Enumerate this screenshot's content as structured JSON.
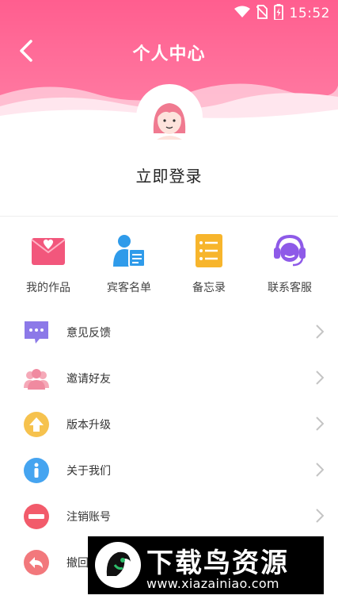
{
  "status_bar": {
    "time": "15:52"
  },
  "header": {
    "title": "个人中心"
  },
  "profile": {
    "login_label": "立即登录"
  },
  "grid": [
    {
      "label": "我的作品",
      "icon": "envelope-heart-icon",
      "color": "#f2577c"
    },
    {
      "label": "宾客名单",
      "icon": "guest-list-icon",
      "color": "#2f9bea"
    },
    {
      "label": "备忘录",
      "icon": "memo-icon",
      "color": "#f7b52c"
    },
    {
      "label": "联系客服",
      "icon": "customer-service-icon",
      "color": "#8e5ae8"
    }
  ],
  "menu": [
    {
      "label": "意见反馈",
      "icon": "feedback-icon",
      "color": "#8c79e8"
    },
    {
      "label": "邀请好友",
      "icon": "invite-friends-icon",
      "color": "#f08aa0"
    },
    {
      "label": "版本升级",
      "icon": "upgrade-icon",
      "color": "#f6c24e"
    },
    {
      "label": "关于我们",
      "icon": "info-icon",
      "color": "#45a4f0"
    },
    {
      "label": "注销账号",
      "icon": "cancel-account-icon",
      "color": "#f25b6b"
    },
    {
      "label": "撤回",
      "icon": "withdraw-icon",
      "color": "#f2787c"
    }
  ],
  "watermark": {
    "title": "下载鸟资源",
    "url": "www.xiazainiao.com"
  }
}
